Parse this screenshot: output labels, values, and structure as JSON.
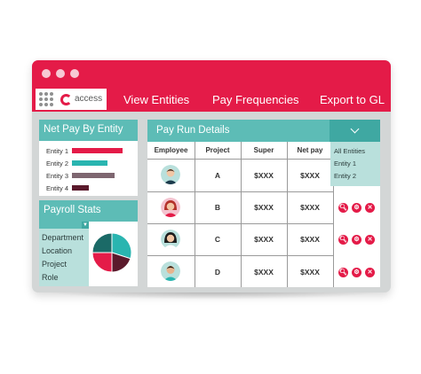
{
  "colors": {
    "brand_red": "#e41b48",
    "teal": "#5dbcb6",
    "teal_dark": "#3fa8a2",
    "teal_light": "#b9e0dc",
    "panel_grey": "#d3d6d6"
  },
  "window_controls": [
    "dot",
    "dot",
    "dot"
  ],
  "brand": {
    "logo_text": "access",
    "apps_icon": "grid-dots-icon"
  },
  "nav": {
    "items": [
      {
        "label": "View Entities"
      },
      {
        "label": "Pay Frequencies"
      },
      {
        "label": "Export to GL"
      }
    ]
  },
  "net_pay": {
    "title": "Net Pay By Entity",
    "rows": [
      {
        "label": "Entity 1",
        "value": 1.0,
        "color": "#e41b48"
      },
      {
        "label": "Entity 2",
        "value": 0.7,
        "color": "#2ab5b0"
      },
      {
        "label": "Entity 3",
        "value": 0.85,
        "color": "#7e6670"
      },
      {
        "label": "Entity 4",
        "value": 0.33,
        "color": "#5b1a2c"
      }
    ]
  },
  "payroll_stats": {
    "title": "Payroll Stats",
    "items": [
      "Department",
      "Location",
      "Project",
      "Role"
    ],
    "pie_slices": [
      {
        "value": 30,
        "color": "#2ab5b0"
      },
      {
        "value": 20,
        "color": "#5b1a2c"
      },
      {
        "value": 25,
        "color": "#e41b48"
      },
      {
        "value": 25,
        "color": "#1b6a67"
      }
    ]
  },
  "pay_run": {
    "title": "Pay Run Details",
    "columns": [
      "Employee",
      "Project",
      "Super",
      "Net pay"
    ],
    "rows": [
      {
        "avatar": "man-avatar-icon",
        "project": "A",
        "super": "$XXX",
        "net_pay": "$XXX"
      },
      {
        "avatar": "woman-avatar-icon",
        "project": "B",
        "super": "$XXX",
        "net_pay": "$XXX"
      },
      {
        "avatar": "woman-avatar-icon",
        "project": "C",
        "super": "$XXX",
        "net_pay": "$XXX"
      },
      {
        "avatar": "man-avatar-icon",
        "project": "D",
        "super": "$XXX",
        "net_pay": "$XXX"
      }
    ],
    "row_actions": [
      "search-icon",
      "gear-icon",
      "close-icon"
    ],
    "entity_menu": [
      "All Entities",
      "Entity 1",
      "Entity 2"
    ]
  }
}
